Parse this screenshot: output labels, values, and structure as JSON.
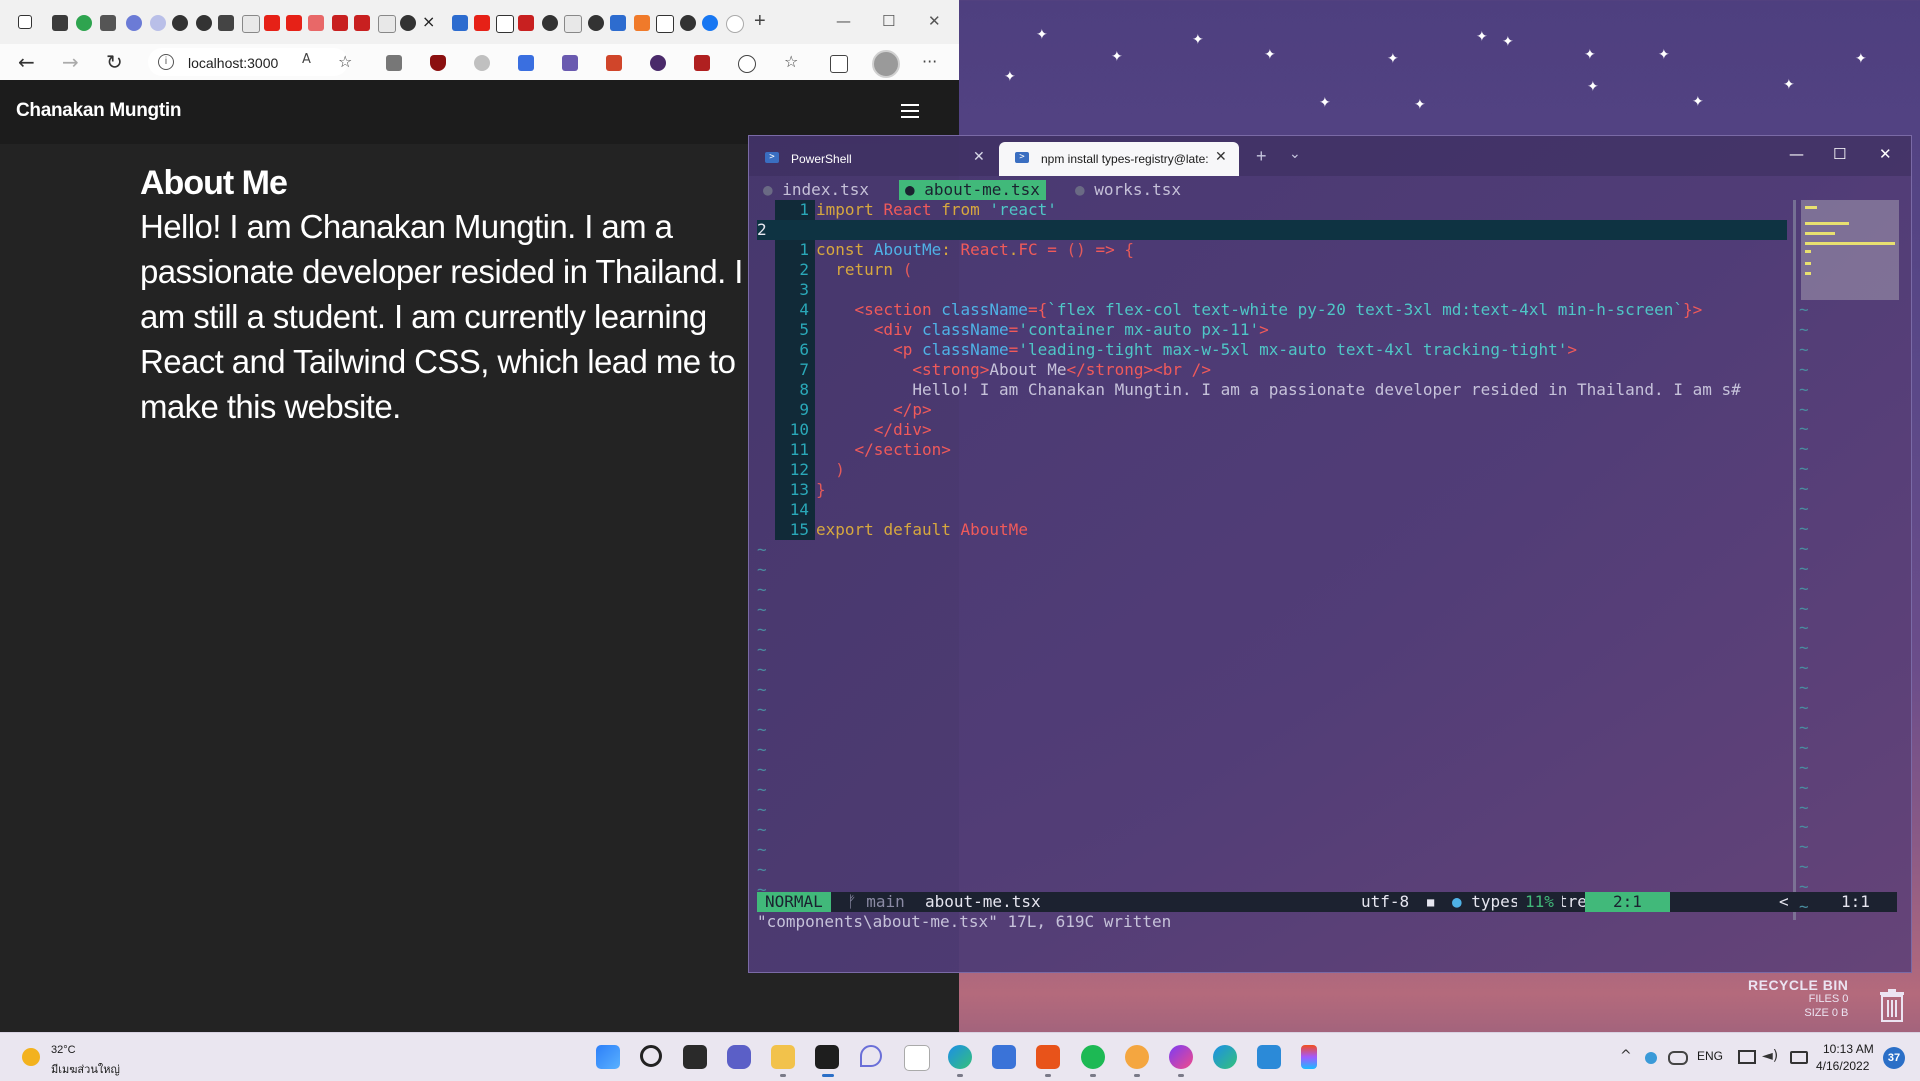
{
  "browser": {
    "tab_close_glyph": "×",
    "new_tab_glyph": "+",
    "window": {
      "minimize": "—",
      "maximize": "☐",
      "close": "✕"
    },
    "nav": {
      "back": "←",
      "forward": "→",
      "reload": "↻"
    },
    "address": {
      "url": "localhost:3000",
      "info_glyph": "i"
    },
    "toolbar": {
      "read_aloud": "A",
      "favorite": "☆",
      "menu": "···"
    }
  },
  "site": {
    "brand": "Chanakan Mungtin",
    "about_title": "About Me",
    "about_body": "Hello! I am Chanakan Mungtin. I am a passionate developer resided in Thailand. I am still a student. I am currently learning React and Tailwind CSS, which lead me to make this website."
  },
  "terminal": {
    "tabs": [
      {
        "label": "PowerShell",
        "close": "✕"
      },
      {
        "label": "npm install types-registry@late:",
        "close": "✕"
      }
    ],
    "new_tab": "+",
    "dropdown": "⌄",
    "window": {
      "minimize": "—",
      "maximize": "☐",
      "close": "✕"
    },
    "vim": {
      "buffers": [
        {
          "dot": "●",
          "name": "index.tsx"
        },
        {
          "dot": "●",
          "name": "about-me.tsx"
        },
        {
          "dot": "●",
          "name": "works.tsx"
        }
      ],
      "lines": [
        {
          "num": "1",
          "html": "<span class='kw'>import</span> <span class='red'>React</span> <span class='kw'>from</span> <span class='str'>'react'</span>"
        },
        {
          "num": "2",
          "html": ""
        },
        {
          "num": "1",
          "html": "<span class='kw'>const</span> <span class='blue'>AboutMe</span><span class='kw'>:</span> <span class='red'>React</span><span class='kw'>.</span><span class='red'>FC</span> <span class='red'>=</span> <span class='brace'>()</span> <span class='red'>=&gt;</span> <span class='brace'>{</span>"
        },
        {
          "num": "2",
          "html": "  <span class='kw'>return</span> <span class='brace'>(</span>"
        },
        {
          "num": "3",
          "html": ""
        },
        {
          "num": "4",
          "html": "    <span class='red'>&lt;section</span> <span class='blue'>className</span><span class='red'>={</span><span class='str'>`flex flex-col text-white py-20 text-3xl md:text-4xl min-h-screen`</span><span class='red'>}&gt;</span>"
        },
        {
          "num": "5",
          "html": "      <span class='red'>&lt;div</span> <span class='blue'>className</span><span class='red'>=</span><span class='str'>'container mx-auto px-11'</span><span class='red'>&gt;</span>"
        },
        {
          "num": "6",
          "html": "        <span class='red'>&lt;p</span> <span class='blue'>className</span><span class='red'>=</span><span class='str'>'leading-tight max-w-5xl mx-auto text-4xl tracking-tight'</span><span class='red'>&gt;</span>"
        },
        {
          "num": "7",
          "html": "          <span class='red'>&lt;strong&gt;</span><span class='code-plain'>About Me</span><span class='red'>&lt;/strong&gt;&lt;br /&gt;</span>"
        },
        {
          "num": "8",
          "html": "          <span class='code-plain'>Hello! I am Chanakan Mungtin. I am a passionate developer resided in Thailand. I am s#</span>"
        },
        {
          "num": "9",
          "html": "        <span class='red'>&lt;/p&gt;</span>"
        },
        {
          "num": "10",
          "html": "      <span class='red'>&lt;/div&gt;</span>"
        },
        {
          "num": "11",
          "html": "    <span class='red'>&lt;/section&gt;</span>"
        },
        {
          "num": "12",
          "html": "  <span class='brace'>)</span>"
        },
        {
          "num": "13",
          "html": "<span class='brace'>}</span>"
        },
        {
          "num": "14",
          "html": ""
        },
        {
          "num": "15",
          "html": "<span class='kw'>export</span> <span class='kw'>default</span> <span class='red'>AboutMe</span>"
        }
      ],
      "tilde": "~",
      "status": {
        "mode": "NORMAL",
        "branch": "ᚠ main",
        "file": "about-me.tsx",
        "encoding": "utf-8",
        "os_icon": "■",
        "filetype_dot": "●",
        "filetype": "typescriptreact",
        "percent": "11%",
        "position": "2:1",
        "split_mark": "<",
        "position_right": "1:1"
      },
      "message": "\"components\\about-me.tsx\" 17L, 619C written"
    }
  },
  "desktop": {
    "recycle_bin": {
      "title": "RECYCLE BIN",
      "files": "FILES 0",
      "size": "SIZE 0 B"
    }
  },
  "taskbar": {
    "weather": {
      "temp": "32°C",
      "location": "มีเมฆส่วนใหญ่"
    },
    "ime": "ENG",
    "clock": {
      "time": "10:13 AM",
      "date": "4/16/2022"
    },
    "notifications": "37",
    "tray_chevron": "^"
  },
  "colors": {
    "vim_green": "#41b97a",
    "line_number": "#2aa8b8",
    "keyword": "#d7a83e",
    "tag": "#f05a5a",
    "attribute": "#4fb2e6",
    "string": "#4fc6c6",
    "site_bg": "#232323"
  }
}
